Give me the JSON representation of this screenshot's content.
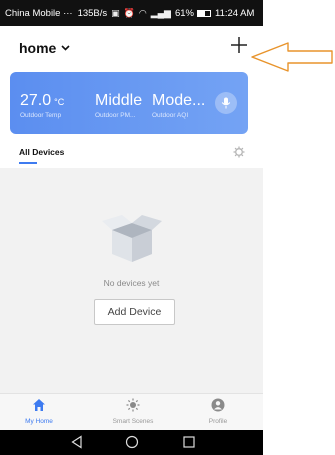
{
  "status_bar": {
    "carrier": "China Mobile ···",
    "speed": "135B/s",
    "signal_label": "ᴴᴰ",
    "battery_percent": "61%",
    "battery_level": 0.61,
    "time": "11:24 AM"
  },
  "header": {
    "home_title": "home"
  },
  "weather": {
    "temp_value": "27.0",
    "temp_unit": "°C",
    "temp_label": "Outdoor Temp",
    "pm_value": "Middle",
    "pm_label": "Outdoor PM...",
    "aqi_value": "Mode...",
    "aqi_label": "Outdoor AQI"
  },
  "devices": {
    "tab_label": "All Devices",
    "empty_text": "No devices yet",
    "add_button_label": "Add Device"
  },
  "tabbar": {
    "items": [
      {
        "label": "My Home",
        "icon": "home-icon",
        "active": true
      },
      {
        "label": "Smart Scenes",
        "icon": "sun-icon",
        "active": false
      },
      {
        "label": "Profile",
        "icon": "profile-icon",
        "active": false
      }
    ]
  },
  "colors": {
    "accent": "#3e7bf0",
    "card_start": "#5b8ef0",
    "card_end": "#74a3f4",
    "annotation_arrow": "#e8942c"
  }
}
